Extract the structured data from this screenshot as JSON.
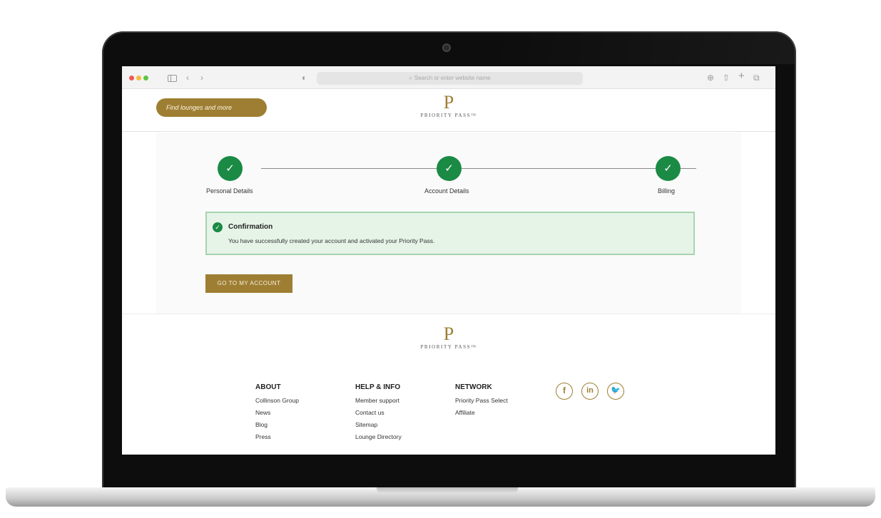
{
  "browser": {
    "url_placeholder": "Search or enter website name"
  },
  "header": {
    "find_button": "Find lounges and more",
    "logo_letter": "P",
    "logo_text": "PRIORITY PASS™"
  },
  "steps": [
    {
      "label": "Personal Details",
      "icon": "✓"
    },
    {
      "label": "Account Details",
      "icon": "✓"
    },
    {
      "label": "Billing",
      "icon": "✓"
    }
  ],
  "confirmation": {
    "title": "Confirmation",
    "message": "You have successfully created your account and activated your Priority Pass.",
    "icon": "✓"
  },
  "account_button": "GO TO MY ACCOUNT",
  "footer": {
    "logo_letter": "P",
    "logo_text": "PRIORITY PASS™",
    "about": {
      "heading": "ABOUT",
      "links": [
        "Collinson Group",
        "News",
        "Blog",
        "Press"
      ]
    },
    "help": {
      "heading": "HELP & INFO",
      "links": [
        "Member support",
        "Contact us",
        "Sitemap",
        "Lounge Directory"
      ]
    },
    "network": {
      "heading": "NETWORK",
      "links": [
        "Priority Pass Select",
        "Affiliate"
      ]
    },
    "social": {
      "facebook": "f",
      "linkedin": "in",
      "twitter": "🐦"
    }
  },
  "colors": {
    "gold": "#9e7e32",
    "success_green": "#1a8a45",
    "confirm_bg": "#e6f4e8"
  }
}
